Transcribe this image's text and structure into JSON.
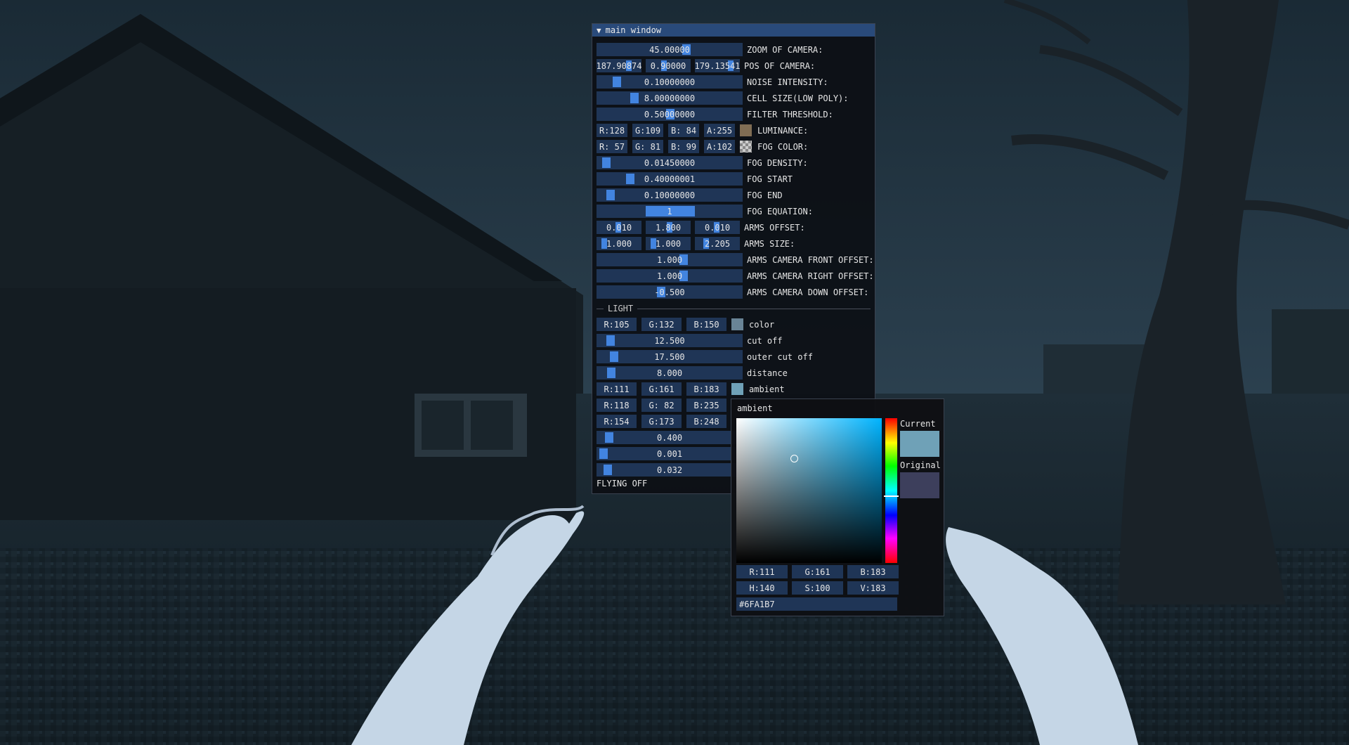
{
  "window": {
    "title": "main window",
    "rows": [
      {
        "kind": "slider",
        "value": "45.00000",
        "grab": 0.62,
        "label": "ZOOM OF CAMERA:"
      },
      {
        "kind": "triple",
        "values": [
          "187.90874",
          "0.90000",
          "179.13541"
        ],
        "grabs": [
          0.8,
          0.4,
          0.9
        ],
        "label": "POS OF CAMERA:"
      },
      {
        "kind": "slider",
        "value": "0.10000000",
        "grab": 0.1,
        "label": "NOISE INTENSITY:"
      },
      {
        "kind": "slider",
        "value": "8.00000000",
        "grab": 0.23,
        "label": "CELL SIZE(LOW POLY):"
      },
      {
        "kind": "slider",
        "value": "0.50000000",
        "grab": 0.5,
        "label": "FILTER THRESHOLD:"
      },
      {
        "kind": "rgba",
        "values": [
          "R:128",
          "G:109",
          "B: 84",
          "A:255"
        ],
        "swatch": "#806d54",
        "label": "LUMINANCE:"
      },
      {
        "kind": "rgba",
        "values": [
          "R: 57",
          "G: 81",
          "B: 99",
          "A:102"
        ],
        "swatch": "checker",
        "label": "FOG COLOR:"
      },
      {
        "kind": "slider",
        "value": "0.01450000",
        "grab": 0.02,
        "label": "FOG DENSITY:"
      },
      {
        "kind": "slider",
        "value": "0.40000001",
        "grab": 0.2,
        "label": "FOG START"
      },
      {
        "kind": "slider",
        "value": "0.10000000",
        "grab": 0.05,
        "label": "FOG END"
      },
      {
        "kind": "slider",
        "value": "1",
        "bar": true,
        "label": "FOG EQUATION:"
      },
      {
        "kind": "triple",
        "values": [
          "0.010",
          "1.800",
          "0.010"
        ],
        "grabs": [
          0.5,
          0.55,
          0.5
        ],
        "label": "ARMS OFFSET:"
      },
      {
        "kind": "triple",
        "values": [
          "1.000",
          "1.000",
          "2.205"
        ],
        "grabs": [
          0.1,
          0.1,
          0.2
        ],
        "label": "ARMS SIZE:"
      },
      {
        "kind": "slider",
        "value": "1.000",
        "grab": 0.6,
        "label": "ARMS CAMERA FRONT OFFSET:"
      },
      {
        "kind": "slider",
        "value": "1.000",
        "grab": 0.6,
        "label": "ARMS CAMERA RIGHT OFFSET:"
      },
      {
        "kind": "slider",
        "value": "-0.500",
        "grab": 0.43,
        "label": "ARMS CAMERA DOWN OFFSET:"
      }
    ],
    "separator": "LIGHT",
    "light_rows": [
      {
        "kind": "rgb",
        "values": [
          "R:105",
          "G:132",
          "B:150"
        ],
        "swatch": "#698496",
        "label": "color"
      },
      {
        "kind": "slider",
        "value": "12.500",
        "grab": 0.05,
        "label": "cut off"
      },
      {
        "kind": "slider",
        "value": "17.500",
        "grab": 0.08,
        "label": "outer cut off"
      },
      {
        "kind": "slider",
        "value": "8.000",
        "grab": 0.06,
        "label": "distance"
      },
      {
        "kind": "rgb",
        "values": [
          "R:111",
          "G:161",
          "B:183"
        ],
        "swatch": "#6fa1b7",
        "label": "ambient"
      },
      {
        "kind": "rgb",
        "values": [
          "R:118",
          "G: 82",
          "B:235"
        ],
        "swatch": "",
        "label": ""
      },
      {
        "kind": "rgb",
        "values": [
          "R:154",
          "G:173",
          "B:248"
        ],
        "swatch": "",
        "label": ""
      },
      {
        "kind": "slider",
        "value": "0.400",
        "grab": 0.04,
        "label": ""
      },
      {
        "kind": "slider",
        "value": "0.001",
        "grab": 0.0,
        "label": ""
      },
      {
        "kind": "slider",
        "value": "0.032",
        "grab": 0.03,
        "label": ""
      }
    ],
    "status": "FLYING OFF"
  },
  "picker": {
    "title": "ambient",
    "current_label": "Current",
    "original_label": "Original",
    "current_color": "#6fa1b7",
    "original_color": "#3d3f5c",
    "rgb": [
      "R:111",
      "G:161",
      "B:183"
    ],
    "hsv": [
      "H:140",
      "S:100",
      "V:183"
    ],
    "hex": "#6FA1B7"
  },
  "colors": {
    "accent": "#4284e0",
    "frame": "#1f3556",
    "title": "#294a7a"
  }
}
